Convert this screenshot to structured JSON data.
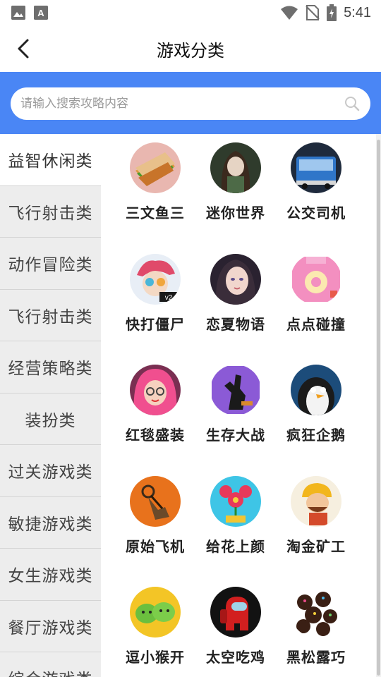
{
  "status_bar": {
    "time": "5:41",
    "left_icons": [
      "image-icon",
      "a-text-icon"
    ],
    "right_icons": [
      "wifi-icon",
      "no-sim-icon",
      "battery-icon"
    ]
  },
  "header": {
    "title": "游戏分类",
    "back_icon": "chevron-left-icon"
  },
  "search": {
    "placeholder": "请输入搜索攻略内容",
    "value": "",
    "icon": "search-icon",
    "band_color": "#4a86f5"
  },
  "sidebar": {
    "items": [
      {
        "label": "益智休闲类",
        "active": true
      },
      {
        "label": "飞行射击类",
        "active": false
      },
      {
        "label": "动作冒险类",
        "active": false
      },
      {
        "label": "飞行射击类",
        "active": false
      },
      {
        "label": "经营策略类",
        "active": false
      },
      {
        "label": "装扮类",
        "active": false
      },
      {
        "label": "过关游戏类",
        "active": false
      },
      {
        "label": "敏捷游戏类",
        "active": false
      },
      {
        "label": "女生游戏类",
        "active": false
      },
      {
        "label": "餐厅游戏类",
        "active": false
      },
      {
        "label": "综合游戏类",
        "active": false
      }
    ]
  },
  "games": [
    {
      "name": "三文鱼三",
      "icon": "sandwich-icon"
    },
    {
      "name": "迷你世界",
      "icon": "anime-girl-icon"
    },
    {
      "name": "公交司机",
      "icon": "bus-icon"
    },
    {
      "name": "快打僵尸",
      "icon": "cartoon-hero-icon"
    },
    {
      "name": "恋夏物语",
      "icon": "portrait-girl-icon"
    },
    {
      "name": "点点碰撞",
      "icon": "donut-icon"
    },
    {
      "name": "红毯盛装",
      "icon": "pink-hair-girl-icon"
    },
    {
      "name": "生存大战",
      "icon": "zombie-silhouette-icon"
    },
    {
      "name": "疯狂企鹅",
      "icon": "penguin-icon"
    },
    {
      "name": "原始飞机",
      "icon": "primitive-plane-icon"
    },
    {
      "name": "给花上颜",
      "icon": "flower-pot-icon"
    },
    {
      "name": "淘金矿工",
      "icon": "miner-icon"
    },
    {
      "name": "逗小猴开",
      "icon": "green-monsters-icon"
    },
    {
      "name": "太空吃鸡",
      "icon": "red-crewmate-icon"
    },
    {
      "name": "黑松露巧",
      "icon": "truffle-candy-icon"
    }
  ]
}
